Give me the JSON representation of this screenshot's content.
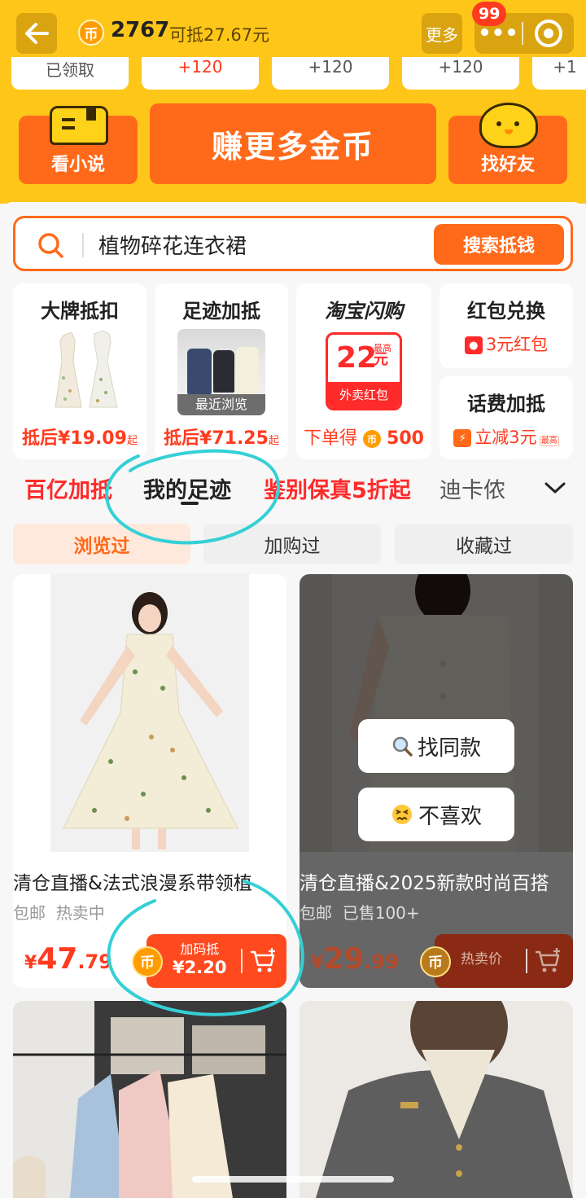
{
  "header": {
    "coin_symbol": "币",
    "coin_count": "2767",
    "coin_worth": "可抵27.67元",
    "more_label": "更多",
    "badge_count": "99"
  },
  "reward_strip": [
    "已领取",
    "+120",
    "+120",
    "+120",
    "+1"
  ],
  "tasks": {
    "novel_label": "看小说",
    "earn_label": "赚更多金币",
    "friends_label": "找好友"
  },
  "search": {
    "query": "植物碎花连衣裙",
    "button_label": "搜索抵钱"
  },
  "promos": {
    "brand": {
      "title": "大牌抵扣",
      "price": "抵后¥19.09",
      "suffix": "起"
    },
    "footprint": {
      "title": "足迹加抵",
      "caption": "最近浏览",
      "price": "抵后¥71.25",
      "suffix": "起"
    },
    "flash": {
      "title": "淘宝闪购",
      "coupon_value": "22",
      "coupon_top": "最高",
      "coupon_unit": "元",
      "coupon_foot": "外卖红包",
      "price_prefix": "下单得",
      "price_value": "500"
    },
    "redpack": {
      "title": "红包兑换",
      "line": "3元红包"
    },
    "phone": {
      "title": "话费加抵",
      "line": "立减3元",
      "tag": "最高"
    }
  },
  "tabs": [
    "百亿加抵",
    "我的足迹",
    "鉴别保真5折起",
    "迪卡侬"
  ],
  "subtabs": [
    "浏览过",
    "加购过",
    "收藏过"
  ],
  "products": [
    {
      "title": "清仓直播&法式浪漫系带领植",
      "sub": [
        "包邮",
        "热卖中"
      ],
      "price_yen": "¥",
      "price_int": "47",
      "price_dec": ".79",
      "pill_line1": "加码抵",
      "pill_line2": "¥2.20"
    },
    {
      "title": "清仓直播&2025新款时尚百搭",
      "sub": [
        "包邮",
        "已售100+"
      ],
      "price_yen": "¥",
      "price_int": "29",
      "price_dec": ".99",
      "pill_line1": "热卖价",
      "overlay_find": "找同款",
      "overlay_dislike": "不喜欢"
    }
  ],
  "colors": {
    "brand_yellow": "#ffc61a",
    "accent_orange": "#ff6a1a",
    "price_red": "#ff3b1f",
    "annotation_cyan": "#35d0d6"
  }
}
